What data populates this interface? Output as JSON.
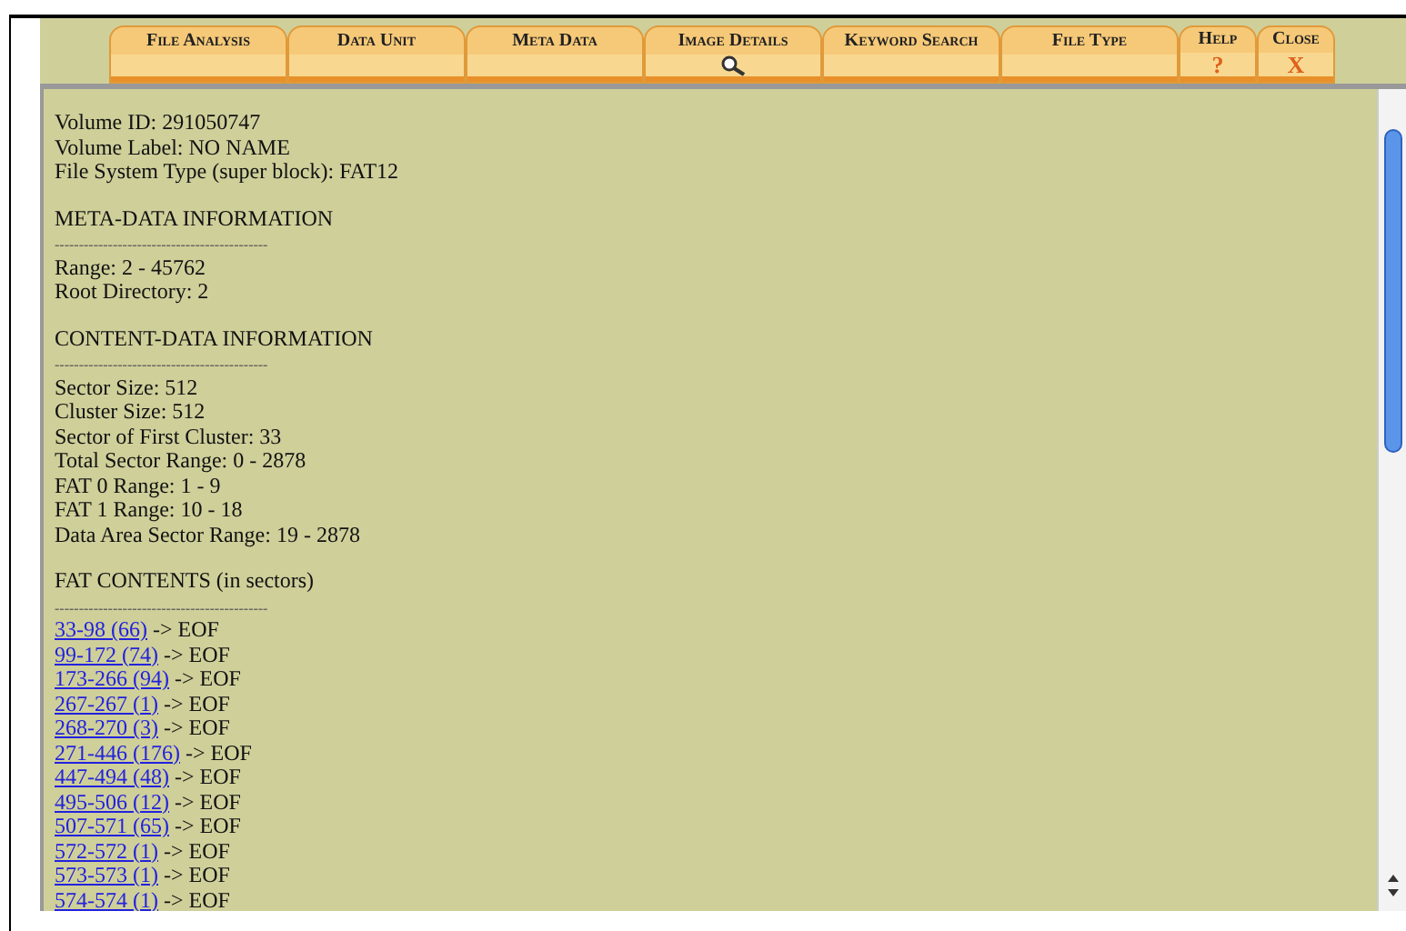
{
  "toolbar": {
    "tabs": [
      {
        "label": "File Analysis",
        "kind": "plain"
      },
      {
        "label": "Data Unit",
        "kind": "plain"
      },
      {
        "label": "Meta Data",
        "kind": "plain"
      },
      {
        "label": "Image Details",
        "kind": "search"
      },
      {
        "label": "Keyword Search",
        "kind": "plain"
      },
      {
        "label": "File Type",
        "kind": "plain"
      },
      {
        "label": "Help",
        "kind": "symbol",
        "symbol": "?"
      },
      {
        "label": "Close",
        "kind": "symbol",
        "symbol": "X"
      }
    ]
  },
  "content": {
    "lines": [
      {
        "kind": "text",
        "text": "Volume ID: 291050747"
      },
      {
        "kind": "text",
        "text": "Volume Label: NO NAME"
      },
      {
        "kind": "text",
        "text": "File System Type (super block): FAT12"
      },
      {
        "kind": "blank"
      },
      {
        "kind": "text",
        "text": "META-DATA INFORMATION"
      },
      {
        "kind": "rule",
        "text": "--------------------------------------------"
      },
      {
        "kind": "text",
        "text": "Range: 2 - 45762"
      },
      {
        "kind": "text",
        "text": "Root Directory: 2"
      },
      {
        "kind": "blank"
      },
      {
        "kind": "text",
        "text": "CONTENT-DATA INFORMATION"
      },
      {
        "kind": "rule",
        "text": "--------------------------------------------"
      },
      {
        "kind": "text",
        "text": "Sector Size: 512"
      },
      {
        "kind": "text",
        "text": "Cluster Size: 512"
      },
      {
        "kind": "text",
        "text": "Sector of First Cluster: 33"
      },
      {
        "kind": "text",
        "text": "Total Sector Range: 0 - 2878"
      },
      {
        "kind": "text",
        "text": "FAT 0 Range: 1 - 9"
      },
      {
        "kind": "text",
        "text": "FAT 1 Range: 10 - 18"
      },
      {
        "kind": "text",
        "text": "Data Area Sector Range: 19 - 2878"
      },
      {
        "kind": "blank"
      },
      {
        "kind": "text",
        "text": "FAT CONTENTS (in sectors)"
      },
      {
        "kind": "rule",
        "text": "--------------------------------------------"
      },
      {
        "kind": "link",
        "link": "33-98 (66)",
        "text": "-> EOF"
      },
      {
        "kind": "link",
        "link": "99-172 (74)",
        "text": "-> EOF"
      },
      {
        "kind": "link",
        "link": "173-266 (94)",
        "text": "-> EOF"
      },
      {
        "kind": "link",
        "link": "267-267 (1)",
        "text": "-> EOF"
      },
      {
        "kind": "link",
        "link": "268-270 (3)",
        "text": "-> EOF"
      },
      {
        "kind": "link",
        "link": "271-446 (176)",
        "text": "-> EOF"
      },
      {
        "kind": "link",
        "link": "447-494 (48)",
        "text": "-> EOF"
      },
      {
        "kind": "link",
        "link": "495-506 (12)",
        "text": "-> EOF"
      },
      {
        "kind": "link",
        "link": "507-571 (65)",
        "text": "-> EOF"
      },
      {
        "kind": "link",
        "link": "572-572 (1)",
        "text": "-> EOF"
      },
      {
        "kind": "link",
        "link": "573-573 (1)",
        "text": "-> EOF"
      },
      {
        "kind": "link",
        "link": "574-574 (1)",
        "text": "-> EOF"
      }
    ]
  }
}
